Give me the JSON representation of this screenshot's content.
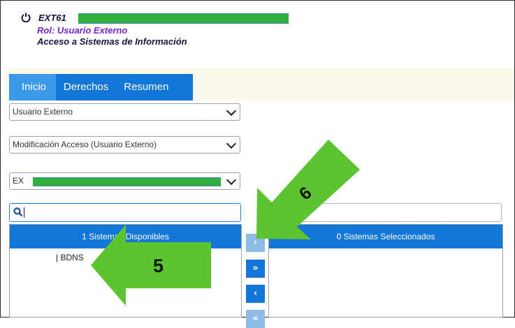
{
  "user": {
    "name_prefix": "EXT61",
    "role": "Rol: Usuario Externo",
    "section": "Acceso a Sistemas de Información"
  },
  "tabs": [
    {
      "label": "Inicio",
      "active": true
    },
    {
      "label": "Derechos",
      "active": false
    },
    {
      "label": "Resumen",
      "active": false
    }
  ],
  "selects": {
    "role_value": "Usuario Externo",
    "operation_value": "Modificación Acceso (Usuario Externo)",
    "user_value_prefix": "EX"
  },
  "available": {
    "header": "1 Sistemas Disponibles",
    "items": [
      "BDNS"
    ]
  },
  "selected": {
    "header": "0 Sistemas Seleccionados",
    "items": []
  },
  "move_buttons": [
    {
      "glyph": "›",
      "name": "move-one-right-button",
      "state": "dim"
    },
    {
      "glyph": "»",
      "name": "move-all-right-button",
      "state": "active"
    },
    {
      "glyph": "‹",
      "name": "move-one-left-button",
      "state": "active"
    },
    {
      "glyph": "«",
      "name": "move-all-left-button",
      "state": "dim"
    }
  ],
  "annotations": {
    "step_5": "5",
    "step_6": "6",
    "color": "#5cc42f"
  },
  "colors": {
    "primary": "#1277d9",
    "role": "#7f22cf",
    "header_bar": "#fdf8ec"
  }
}
